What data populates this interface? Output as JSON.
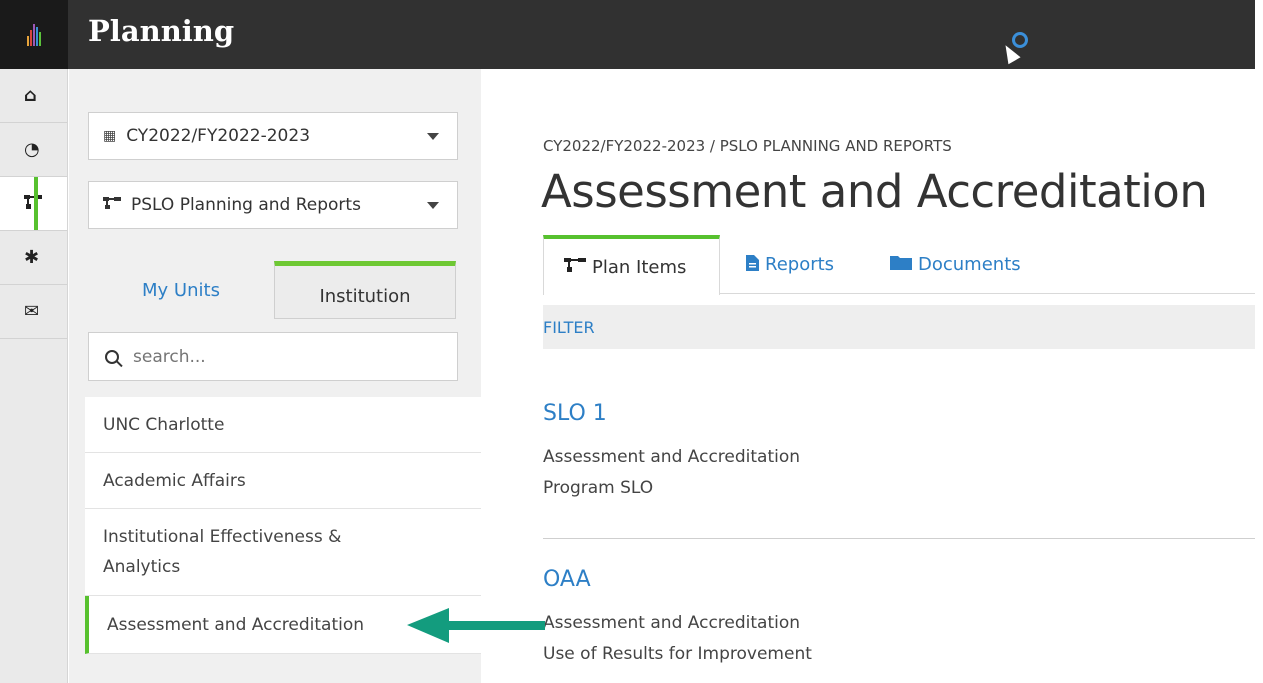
{
  "app": {
    "title": "Planning"
  },
  "rail": {
    "items": [
      {
        "icon": "home-icon",
        "glyph": "⌂"
      },
      {
        "icon": "dashboard-icon",
        "glyph": "◔"
      },
      {
        "icon": "sitemap-icon",
        "glyph": "⊓"
      },
      {
        "icon": "gear-icon",
        "glyph": "✱"
      },
      {
        "icon": "envelope-icon",
        "glyph": "✉"
      }
    ]
  },
  "sidebar": {
    "cycle_select": "CY2022/FY2022-2023",
    "plan_select": "PSLO Planning and Reports",
    "tabs": {
      "my_units": "My Units",
      "institution": "Institution"
    },
    "search_placeholder": "search...",
    "units": [
      "UNC Charlotte",
      "Academic Affairs",
      "Institutional Effectiveness & Analytics",
      "Assessment and Accreditation"
    ]
  },
  "main": {
    "breadcrumb": "CY2022/FY2022-2023 / PSLO PLANNING AND REPORTS",
    "title": "Assessment and Accreditation",
    "tabs": {
      "plan_items": "Plan Items",
      "reports": "Reports",
      "documents": "Documents"
    },
    "filter": "FILTER",
    "plan_items": [
      {
        "title": "SLO 1",
        "line1": "Assessment and Accreditation",
        "line2": "Program SLO"
      },
      {
        "title": "OAA",
        "line1": "Assessment and Accreditation",
        "line2": "Use of Results for Improvement"
      }
    ]
  },
  "colors": {
    "accent_green": "#57c12e",
    "link_blue": "#2d7fc6",
    "header_dark": "#313131",
    "arrow_teal": "#139c7e"
  }
}
